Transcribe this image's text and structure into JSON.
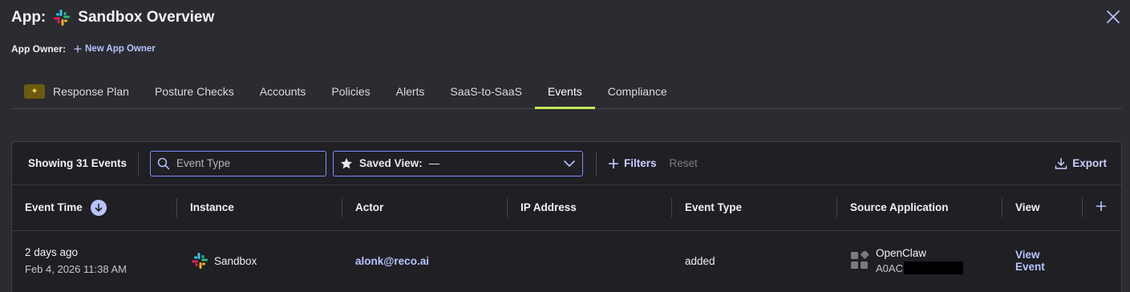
{
  "header": {
    "title_prefix": "App:",
    "app_name": "Sandbox Overview",
    "icons": {
      "app": "slack-icon",
      "close": "close-icon"
    }
  },
  "owner": {
    "label": "App Owner:",
    "add_label": "New App Owner"
  },
  "tabs": [
    {
      "label": "Response Plan",
      "icon": "sparkle-icon",
      "active": false
    },
    {
      "label": "Posture Checks",
      "active": false
    },
    {
      "label": "Accounts",
      "active": false
    },
    {
      "label": "Policies",
      "active": false
    },
    {
      "label": "Alerts",
      "active": false
    },
    {
      "label": "SaaS-to-SaaS",
      "active": false
    },
    {
      "label": "Events",
      "active": true
    },
    {
      "label": "Compliance",
      "active": false
    }
  ],
  "toolbar": {
    "showing": "Showing 31 Events",
    "search_placeholder": "Event Type",
    "saved_view_label": "Saved View:",
    "saved_view_value": "—",
    "filters_label": "Filters",
    "reset_label": "Reset",
    "export_label": "Export"
  },
  "table": {
    "columns": [
      "Event Time",
      "Instance",
      "Actor",
      "IP Address",
      "Event Type",
      "Source Application",
      "View"
    ],
    "rows": [
      {
        "time_relative": "2 days ago",
        "time_absolute": "Feb 4, 2026 11:38 AM",
        "instance": "Sandbox",
        "actor": "alonk@reco.ai",
        "ip_address": "",
        "event_type": "added",
        "source_name": "OpenClaw",
        "source_id": "A0AC",
        "view_label": "View Event"
      }
    ]
  },
  "colors": {
    "background": "#2b2b31",
    "panel": "#1f1f24",
    "accent": "#b9c4ff",
    "active_tab_underline": "#c6e85a",
    "input_border": "#7f8dff"
  }
}
